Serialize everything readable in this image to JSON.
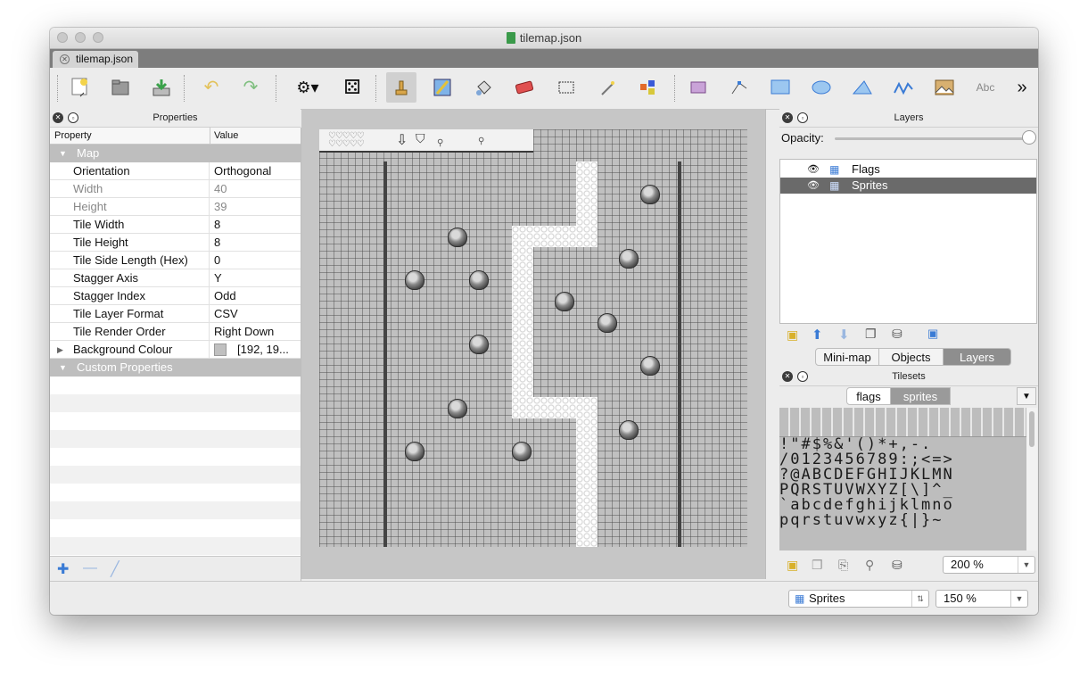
{
  "window": {
    "title": "tilemap.json"
  },
  "document_tab": {
    "label": "tilemap.json"
  },
  "toolbar": {
    "buttons": [
      "new-map-icon",
      "open-icon",
      "save-icon",
      "undo-icon",
      "redo-icon",
      "random-mode-icon",
      "dice-icon",
      "stamp-brush-icon",
      "terrain-brush-icon",
      "bucket-fill-icon",
      "eraser-icon",
      "rectangular-select-icon",
      "magic-wand-icon",
      "select-same-tile-icon",
      "select-objects-icon",
      "edit-polygons-icon",
      "insert-rectangle-icon",
      "insert-ellipse-icon",
      "insert-polygon-icon",
      "insert-polyline-icon",
      "insert-tile-icon",
      "insert-text-icon"
    ],
    "text_tool_label": "Abc",
    "overflow": "»"
  },
  "properties": {
    "title": "Properties",
    "col_property": "Property",
    "col_value": "Value",
    "map_group": "Map",
    "rows": [
      {
        "key": "Orientation",
        "value": "Orthogonal",
        "dim": false
      },
      {
        "key": "Width",
        "value": "40",
        "dim": true
      },
      {
        "key": "Height",
        "value": "39",
        "dim": true
      },
      {
        "key": "Tile Width",
        "value": "8",
        "dim": false
      },
      {
        "key": "Tile Height",
        "value": "8",
        "dim": false
      },
      {
        "key": "Tile Side Length (Hex)",
        "value": "0",
        "dim": false
      },
      {
        "key": "Stagger Axis",
        "value": "Y",
        "dim": false
      },
      {
        "key": "Stagger Index",
        "value": "Odd",
        "dim": false
      },
      {
        "key": "Tile Layer Format",
        "value": "CSV",
        "dim": false
      },
      {
        "key": "Tile Render Order",
        "value": "Right Down",
        "dim": false
      },
      {
        "key": "Background Colour",
        "value": "[192, 19...",
        "dim": false
      }
    ],
    "custom_group": "Custom Properties",
    "background_swatch": "#c0c0c0"
  },
  "layers": {
    "title": "Layers",
    "opacity_label": "Opacity:",
    "opacity": 1.0,
    "items": [
      {
        "name": "Flags",
        "selected": false
      },
      {
        "name": "Sprites",
        "selected": true
      }
    ],
    "tabs": [
      "Mini-map",
      "Objects",
      "Layers"
    ]
  },
  "tilesets": {
    "title": "Tilesets",
    "tabs": [
      "flags",
      "sprites"
    ],
    "glyph_rows": [
      "!\"#$%&'()*+,-.",
      "/0123456789:;<=>",
      "?@ABCDEFGHIJKLMN",
      "PQRSTUVWXYZ[\\]^_",
      "`abcdefghijklmno",
      "pqrstuvwxyz{|}~"
    ],
    "zoom": "200 %"
  },
  "status": {
    "layer": "Sprites",
    "zoom": "150 %"
  },
  "colors": {
    "map_background": "#c0c0c0",
    "selected_layer": "#6a6a6a",
    "accent_blue": "#3a7bd5"
  }
}
